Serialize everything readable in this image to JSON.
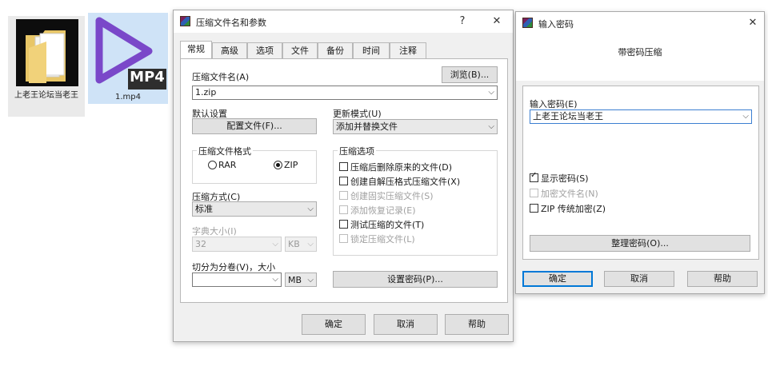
{
  "desktop": {
    "folder_icon_label": "上老王论坛当老王",
    "mp4_icon_badge": "MP4",
    "mp4_icon_label": "1.mp4"
  },
  "archive_dialog": {
    "title": "压缩文件名和参数",
    "help_glyph": "?",
    "close_glyph": "✕",
    "tabs": [
      "常规",
      "高级",
      "选项",
      "文件",
      "备份",
      "时间",
      "注释"
    ],
    "archive_name_label": "压缩文件名(A)",
    "browse_button": "浏览(B)...",
    "archive_name_value": "1.zip",
    "default_settings_label": "默认设置",
    "profiles_button": "配置文件(F)...",
    "update_mode_label": "更新模式(U)",
    "update_mode_value": "添加并替换文件",
    "format_group_title": "压缩文件格式",
    "format_rar": "RAR",
    "format_zip": "ZIP",
    "options_group_title": "压缩选项",
    "options": [
      {
        "label": "压缩后删除原来的文件(D)",
        "checked": false,
        "enabled": true
      },
      {
        "label": "创建自解压格式压缩文件(X)",
        "checked": false,
        "enabled": true
      },
      {
        "label": "创建固实压缩文件(S)",
        "checked": false,
        "enabled": false
      },
      {
        "label": "添加恢复记录(E)",
        "checked": false,
        "enabled": false
      },
      {
        "label": "测试压缩的文件(T)",
        "checked": false,
        "enabled": true
      },
      {
        "label": "锁定压缩文件(L)",
        "checked": false,
        "enabled": false
      }
    ],
    "method_label": "压缩方式(C)",
    "method_value": "标准",
    "dict_label": "字典大小(I)",
    "dict_value": "32",
    "dict_unit": "KB",
    "split_label": "切分为分卷(V)，大小",
    "split_value": "",
    "split_unit": "MB",
    "set_password_button": "设置密码(P)...",
    "ok_button": "确定",
    "cancel_button": "取消",
    "help_button": "帮助"
  },
  "password_dialog": {
    "title": "输入密码",
    "close_glyph": "✕",
    "heading": "带密码压缩",
    "password_label": "输入密码(E)",
    "password_value": "上老王论坛当老王",
    "show_password": "显示密码(S)",
    "encrypt_names": "加密文件名(N)",
    "zip_legacy": "ZIP 传统加密(Z)",
    "organize_button": "整理密码(O)...",
    "ok_button": "确定",
    "cancel_button": "取消",
    "help_button": "帮助"
  },
  "colors": {
    "focus_blue": "#0078d7",
    "selection": "#cfe3f7"
  }
}
